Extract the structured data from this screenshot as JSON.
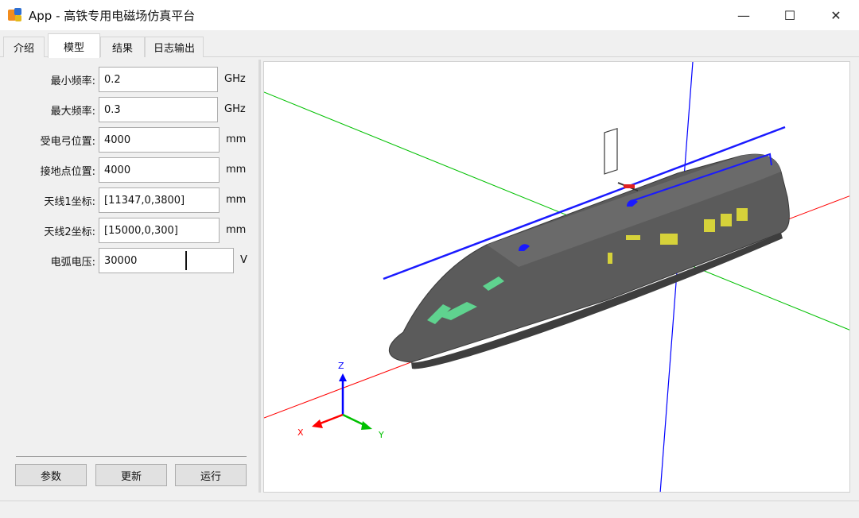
{
  "window": {
    "title": "App - 高铁专用电磁场仿真平台",
    "minimize": "—",
    "maximize": "☐",
    "close": "✕"
  },
  "tabs": [
    {
      "label": "介绍"
    },
    {
      "label": "模型"
    },
    {
      "label": "结果"
    },
    {
      "label": "日志输出"
    }
  ],
  "form": {
    "min_freq": {
      "label": "最小频率:",
      "value": "0.2",
      "unit": "GHz"
    },
    "max_freq": {
      "label": "最大频率:",
      "value": "0.3",
      "unit": "GHz"
    },
    "pantograph_pos": {
      "label": "受电弓位置:",
      "value": "4000",
      "unit": "mm"
    },
    "ground_pos": {
      "label": "接地点位置:",
      "value": "4000",
      "unit": "mm"
    },
    "antenna1": {
      "label": "天线1坐标:",
      "value": "[11347,0,3800]",
      "unit": "mm"
    },
    "antenna2": {
      "label": "天线2坐标:",
      "value": "[15000,0,300]",
      "unit": "mm"
    },
    "arc_voltage": {
      "label": "电弧电压:",
      "value": "30000",
      "unit": "V"
    }
  },
  "buttons": {
    "params": "参数",
    "update": "更新",
    "run": "运行"
  },
  "viewport": {
    "axis_z": "Z",
    "axis_x": "X",
    "axis_y": "Y",
    "colors": {
      "x_axis": "#ff0000",
      "y_axis": "#00c000",
      "z_axis": "#0000ff",
      "train_body": "#555555",
      "windows": "#d6d23a",
      "glass": "#5fd38f",
      "wire": "#1a1aff"
    }
  }
}
